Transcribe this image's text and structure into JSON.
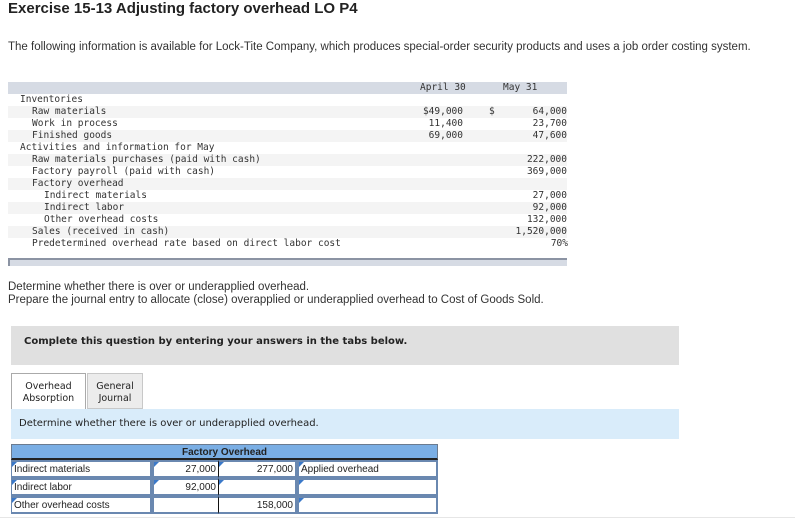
{
  "title": "Exercise 15-13 Adjusting factory overhead LO P4",
  "intro": "The following information is available for Lock-Tite Company, which produces special-order security products and uses a job order costing system.",
  "data_table": {
    "col_headers": [
      "April 30",
      "May 31"
    ],
    "rows": [
      {
        "label": "Inventories",
        "indent": 0,
        "april": "",
        "may": "",
        "dollar": ""
      },
      {
        "label": "Raw materials",
        "indent": 1,
        "april": "$49,000",
        "may": "64,000",
        "dollar": "$"
      },
      {
        "label": "Work in process",
        "indent": 1,
        "april": "11,400",
        "may": "23,700",
        "dollar": ""
      },
      {
        "label": "Finished goods",
        "indent": 1,
        "april": "69,000",
        "may": "47,600",
        "dollar": ""
      },
      {
        "label": "Activities and information for May",
        "indent": 0,
        "april": "",
        "may": "",
        "dollar": ""
      },
      {
        "label": "Raw materials purchases (paid with cash)",
        "indent": 1,
        "april": "",
        "may": "222,000",
        "dollar": ""
      },
      {
        "label": "Factory payroll (paid with cash)",
        "indent": 1,
        "april": "",
        "may": "369,000",
        "dollar": ""
      },
      {
        "label": "Factory overhead",
        "indent": 1,
        "april": "",
        "may": "",
        "dollar": ""
      },
      {
        "label": "Indirect materials",
        "indent": 2,
        "april": "",
        "may": "27,000",
        "dollar": ""
      },
      {
        "label": "Indirect labor",
        "indent": 2,
        "april": "",
        "may": "92,000",
        "dollar": ""
      },
      {
        "label": "Other overhead costs",
        "indent": 2,
        "april": "",
        "may": "132,000",
        "dollar": ""
      },
      {
        "label": "Sales (received in cash)",
        "indent": 1,
        "april": "",
        "may": "1,520,000",
        "dollar": ""
      },
      {
        "label": "Predetermined overhead rate based on direct labor cost",
        "indent": 1,
        "april": "",
        "may": "70%",
        "dollar": ""
      }
    ]
  },
  "task_lines": [
    "Determine whether there is over or underapplied overhead.",
    "Prepare the journal entry to allocate (close) overapplied or underapplied overhead to Cost of Goods Sold."
  ],
  "banner": "Complete this question by entering your answers in the tabs below.",
  "tabs": [
    {
      "label_line1": "Overhead",
      "label_line2": "Absorption",
      "active": true
    },
    {
      "label_line1": "General",
      "label_line2": "Journal",
      "active": false
    }
  ],
  "instruction": "Determine whether there is over or underapplied overhead.",
  "t_account": {
    "title": "Factory Overhead",
    "rows": [
      {
        "debit_label": "Indirect materials",
        "debit": "27,000",
        "credit": "277,000",
        "credit_label": "Applied overhead"
      },
      {
        "debit_label": "Indirect labor",
        "debit": "92,000",
        "credit": "",
        "credit_label": ""
      },
      {
        "debit_label": "Other overhead costs",
        "debit": "",
        "credit": "158,000",
        "credit_label": ""
      }
    ]
  },
  "colors": {
    "t_header": "#7aaee4",
    "instruction_bg": "#d9ecfa",
    "banner_bg": "#e0e0e0",
    "table_header_bg": "#d6dbe4"
  }
}
